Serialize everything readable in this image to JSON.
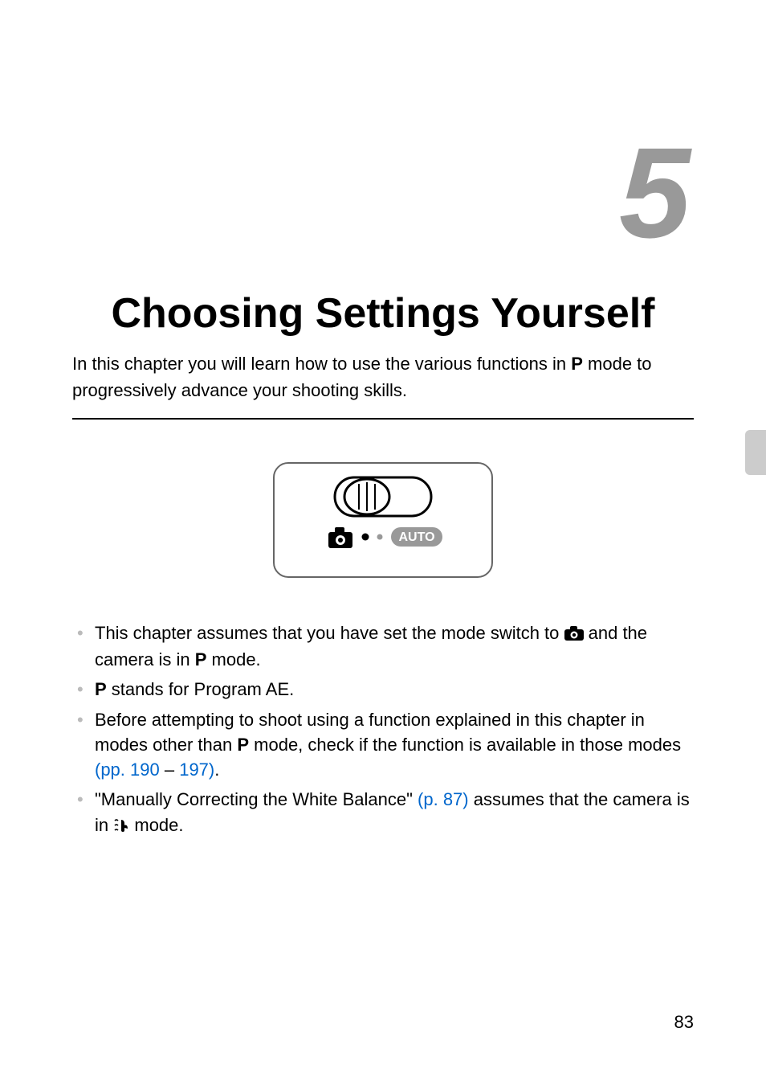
{
  "chapter_number": "5",
  "chapter_title": "Choosing Settings Yourself",
  "intro": {
    "part1": "In this chapter you will learn how to use the various functions in ",
    "p_icon": "P",
    "part2": " mode to progressively advance your shooting skills."
  },
  "figure": {
    "auto_label": "AUTO"
  },
  "bullets": {
    "b1": {
      "part1": "This chapter assumes that you have set the mode switch to ",
      "part2": " and the camera is in ",
      "p_icon": "P",
      "part3": " mode."
    },
    "b2": {
      "p_icon": "P",
      "text": " stands for Program AE."
    },
    "b3": {
      "part1": "Before attempting to shoot using a function explained in this chapter in modes other than ",
      "p_icon": "P",
      "part2": " mode, check if the function is available in those modes ",
      "link1": "(pp. 190",
      "dash": " – ",
      "link2": "197)",
      "period": "."
    },
    "b4": {
      "part1": "\"Manually Correcting the White Balance\" ",
      "link": "(p. 87)",
      "part2": " assumes that the camera is in ",
      "part3": " mode."
    }
  },
  "page_number": "83"
}
